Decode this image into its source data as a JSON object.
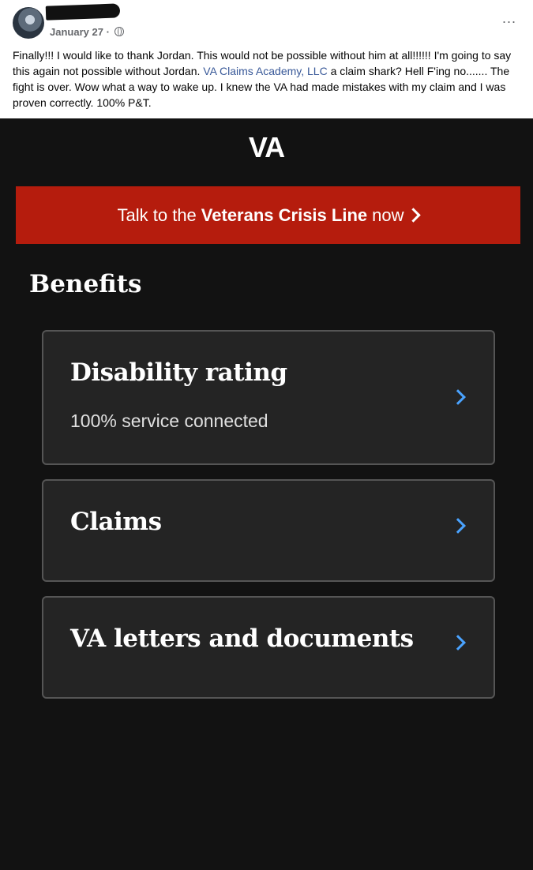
{
  "post": {
    "date": "January 27",
    "separator": "·",
    "text_before_link": "Finally!!! I would like to thank Jordan. This would not be possible without him at all!!!!!! I'm going to say this again not possible without Jordan. ",
    "link_text": "VA Claims Academy, LLC",
    "text_after_link": " a claim shark? Hell F'ing no....... The fight is over. Wow what a way to wake up. I knew the VA had made mistakes with my claim and I was proven correctly. 100% P&T.",
    "more_label": "..."
  },
  "app": {
    "logo": "VA",
    "banner": {
      "prefix": "Talk to the",
      "bold": "Veterans Crisis Line",
      "suffix": "now"
    },
    "section_title": "Benefits",
    "cards": [
      {
        "title": "Disability rating",
        "subtitle": "100% service connected"
      },
      {
        "title": "Claims"
      },
      {
        "title": "VA letters and documents"
      }
    ]
  },
  "colors": {
    "banner": "#b51c0d",
    "chevron": "#4aa3ff",
    "background": "#121212",
    "link": "#385898"
  },
  "icons": {
    "banner_arrow": "chevron-right-icon",
    "card_arrow": "chevron-right-icon",
    "privacy": "globe-icon",
    "menu": "more-icon"
  }
}
